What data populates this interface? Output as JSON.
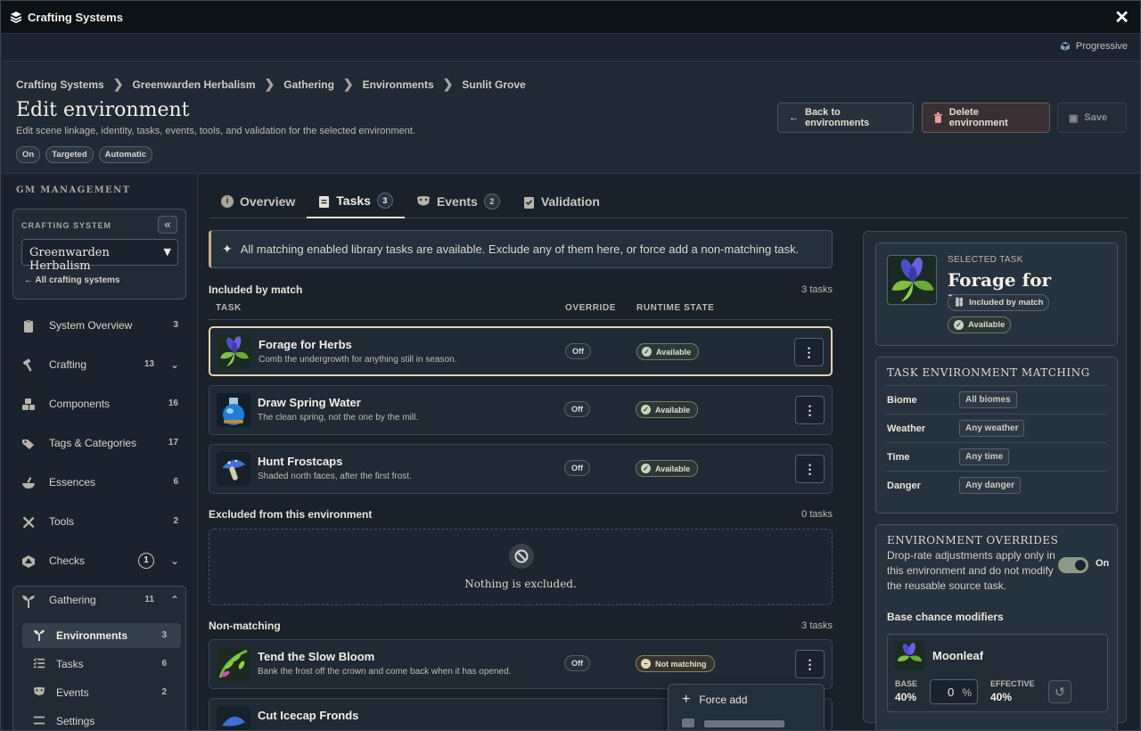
{
  "app": {
    "title": "Crafting Systems",
    "mode": "Progressive"
  },
  "breadcrumbs": [
    "Crafting Systems",
    "Greenwarden Herbalism",
    "Gathering",
    "Environments",
    "Sunlit Grove"
  ],
  "page": {
    "title": "Edit environment",
    "subtitle": "Edit scene linkage, identity, tasks, events, tools, and validation for the selected environment.",
    "pills": [
      "On",
      "Targeted",
      "Automatic"
    ],
    "buttons": {
      "back": "Back to environments",
      "delete": "Delete environment",
      "save": "Save"
    }
  },
  "sidebar": {
    "heading": "GM MANAGEMENT",
    "card_label": "CRAFTING SYSTEM",
    "system": "Greenwarden Herbalism",
    "all_link": "All crafting systems",
    "items": [
      {
        "label": "System Overview",
        "count": "3"
      },
      {
        "label": "Crafting",
        "count": "13"
      },
      {
        "label": "Components",
        "count": "16"
      },
      {
        "label": "Tags & Categories",
        "count": "17"
      },
      {
        "label": "Essences",
        "count": "6"
      },
      {
        "label": "Tools",
        "count": "2"
      },
      {
        "label": "Checks",
        "count": "1"
      },
      {
        "label": "Gathering",
        "count": "11"
      }
    ],
    "sub_items": [
      {
        "label": "Environments",
        "count": "3"
      },
      {
        "label": "Tasks",
        "count": "6"
      },
      {
        "label": "Events",
        "count": "2"
      },
      {
        "label": "Settings",
        "count": ""
      }
    ]
  },
  "tabs": [
    {
      "label": "Overview",
      "count": ""
    },
    {
      "label": "Tasks",
      "count": "3"
    },
    {
      "label": "Events",
      "count": "2"
    },
    {
      "label": "Validation",
      "count": ""
    }
  ],
  "notice": "All matching enabled library tasks are available. Exclude any of them here, or force add a non-matching task.",
  "columns": {
    "task": "TASK",
    "override": "OVERRIDE",
    "state": "RUNTIME STATE"
  },
  "sections": {
    "included": {
      "title": "Included by match",
      "count": "3 tasks"
    },
    "excluded": {
      "title": "Excluded from this environment",
      "count": "0 tasks",
      "empty": "Nothing is excluded."
    },
    "nonmatching": {
      "title": "Non-matching",
      "count": "3 tasks"
    }
  },
  "included_tasks": [
    {
      "name": "Forage for Herbs",
      "desc": "Comb the undergrowth for anything still in season.",
      "override": "Off",
      "state": "Available"
    },
    {
      "name": "Draw Spring Water",
      "desc": "The clean spring, not the one by the mill.",
      "override": "Off",
      "state": "Available"
    },
    {
      "name": "Hunt Frostcaps",
      "desc": "Shaded north faces, after the first frost.",
      "override": "Off",
      "state": "Available"
    }
  ],
  "nonmatching_tasks": [
    {
      "name": "Tend the Slow Bloom",
      "desc": "Bank the frost off the crown and come back when it has opened.",
      "override": "Off",
      "state": "Not matching"
    },
    {
      "name": "Cut Icecap Fronds",
      "desc": "",
      "override": "",
      "state": ""
    }
  ],
  "context_menu": {
    "items": [
      "Force add"
    ]
  },
  "selected": {
    "label": "SELECTED TASK",
    "name": "Forage for Herbs",
    "badges": [
      "Included by match",
      "Available"
    ]
  },
  "matching": {
    "title": "TASK ENVIRONMENT MATCHING",
    "rows": [
      {
        "key": "Biome",
        "value": "All biomes"
      },
      {
        "key": "Weather",
        "value": "Any weather"
      },
      {
        "key": "Time",
        "value": "Any time"
      },
      {
        "key": "Danger",
        "value": "Any danger"
      }
    ]
  },
  "overrides": {
    "title": "ENVIRONMENT OVERRIDES",
    "desc": "Drop-rate adjustments apply only in this environment and do not modify the reusable source task.",
    "toggle_label": "On",
    "toggle_on": true,
    "modifiers_title": "Base chance modifiers",
    "component": {
      "name": "Moonleaf",
      "base_label": "BASE",
      "base": "40%",
      "input": "0",
      "unit": "%",
      "effective_label": "EFFECTIVE",
      "effective": "40%"
    }
  }
}
